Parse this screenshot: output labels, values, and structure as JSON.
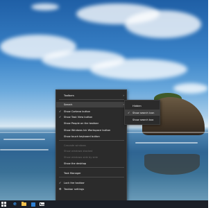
{
  "context_menu": {
    "items": [
      {
        "label": "Toolbars",
        "has_submenu": true,
        "checked": false,
        "disabled": false,
        "active": false
      },
      {
        "label": "Search",
        "has_submenu": true,
        "checked": false,
        "disabled": false,
        "active": true
      },
      {
        "label": "Show Cortana button",
        "has_submenu": false,
        "checked": true,
        "disabled": false,
        "active": false
      },
      {
        "label": "Show Task View button",
        "has_submenu": false,
        "checked": true,
        "disabled": false,
        "active": false
      },
      {
        "label": "Show People on the taskbar",
        "has_submenu": false,
        "checked": false,
        "disabled": false,
        "active": false
      },
      {
        "label": "Show Windows Ink Workspace button",
        "has_submenu": false,
        "checked": false,
        "disabled": false,
        "active": false
      },
      {
        "label": "Show touch keyboard button",
        "has_submenu": false,
        "checked": false,
        "disabled": false,
        "active": false
      },
      {
        "label": "Cascade windows",
        "has_submenu": false,
        "checked": false,
        "disabled": true,
        "active": false
      },
      {
        "label": "Show windows stacked",
        "has_submenu": false,
        "checked": false,
        "disabled": true,
        "active": false
      },
      {
        "label": "Show windows side by side",
        "has_submenu": false,
        "checked": false,
        "disabled": true,
        "active": false
      },
      {
        "label": "Show the desktop",
        "has_submenu": false,
        "checked": false,
        "disabled": false,
        "active": false
      },
      {
        "label": "Task Manager",
        "has_submenu": false,
        "checked": false,
        "disabled": false,
        "active": false
      },
      {
        "label": "Lock the taskbar",
        "has_submenu": false,
        "checked": true,
        "disabled": false,
        "active": false
      },
      {
        "label": "Taskbar settings",
        "has_submenu": false,
        "checked": false,
        "disabled": false,
        "active": false,
        "icon": "gear-icon"
      }
    ],
    "check_glyph": "✓",
    "arrow_glyph": "›",
    "gear_glyph": "⚙"
  },
  "search_submenu": {
    "items": [
      {
        "label": "Hidden",
        "checked": false,
        "active": false
      },
      {
        "label": "Show search icon",
        "checked": true,
        "active": true
      },
      {
        "label": "Show search box",
        "checked": false,
        "active": false
      }
    ]
  },
  "taskbar": {
    "icons": [
      "windows-start-icon",
      "edge-icon",
      "file-explorer-icon",
      "store-icon",
      "mail-icon"
    ],
    "edge_glyph": "e"
  },
  "colors": {
    "menu_bg": "#2b2b2b",
    "menu_hover": "#414141",
    "menu_text": "#f2f2f2",
    "disabled_text": "#6e6e6e",
    "taskbar_bg": "#1b1f27",
    "edge_blue": "#3a8fe0",
    "folder_yellow": "#f2c14e"
  }
}
